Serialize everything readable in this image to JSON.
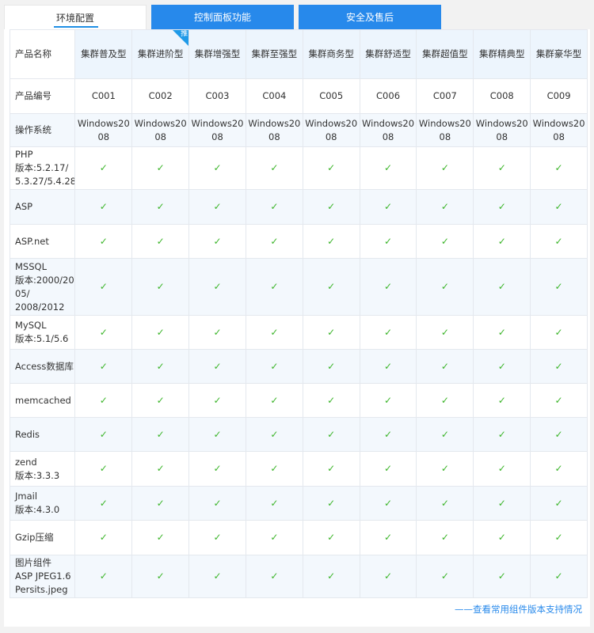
{
  "tabs": [
    {
      "label": "环境配置",
      "active": true
    },
    {
      "label": "控制面板功能",
      "active": false
    },
    {
      "label": "安全及售后",
      "active": false
    }
  ],
  "row_labels": {
    "name": "产品名称",
    "code": "产品编号",
    "os": "操作系统"
  },
  "products": [
    {
      "name": "集群普及型",
      "code": "C001",
      "os": "Windows2008"
    },
    {
      "name": "集群进阶型",
      "code": "C002",
      "os": "Windows2008",
      "badge": "推"
    },
    {
      "name": "集群增强型",
      "code": "C003",
      "os": "Windows2008"
    },
    {
      "name": "集群至强型",
      "code": "C004",
      "os": "Windows2008"
    },
    {
      "name": "集群商务型",
      "code": "C005",
      "os": "Windows2008"
    },
    {
      "name": "集群舒适型",
      "code": "C006",
      "os": "Windows2008"
    },
    {
      "name": "集群超值型",
      "code": "C007",
      "os": "Windows2008"
    },
    {
      "name": "集群精典型",
      "code": "C008",
      "os": "Windows2008"
    },
    {
      "name": "集群豪华型",
      "code": "C009",
      "os": "Windows2008"
    }
  ],
  "features": [
    {
      "lines": [
        "PHP",
        "版本:5.2.17/",
        "5.3.27/5.4.28"
      ]
    },
    {
      "lines": [
        "ASP"
      ]
    },
    {
      "lines": [
        "ASP.net"
      ]
    },
    {
      "lines": [
        "MSSQL",
        "版本:2000/20",
        "05/",
        "2008/2012"
      ]
    },
    {
      "lines": [
        "MySQL",
        "版本:5.1/5.6"
      ]
    },
    {
      "lines": [
        "Access数据库"
      ]
    },
    {
      "lines": [
        "memcached"
      ]
    },
    {
      "lines": [
        "Redis"
      ]
    },
    {
      "lines": [
        "zend",
        "版本:3.3.3"
      ]
    },
    {
      "lines": [
        "Jmail",
        "版本:4.3.0"
      ]
    },
    {
      "lines": [
        "Gzip压缩"
      ]
    },
    {
      "lines": [
        "图片组件",
        "ASP JPEG1.6",
        "Persits.jpeg"
      ]
    }
  ],
  "check_symbol": "✓",
  "footer_link": "——查看常用组件版本支持情况",
  "colors": {
    "accent": "#2789eb",
    "check": "#3cb52a",
    "stripe": "#f3f8fd"
  }
}
